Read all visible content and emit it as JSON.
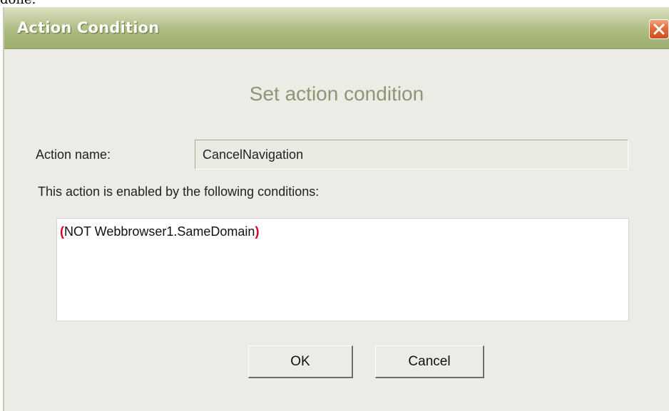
{
  "page": {
    "top_fragment": "done."
  },
  "dialog": {
    "title": "Action Condition",
    "close_icon": "close-icon",
    "heading": "Set action condition",
    "action_name_label": "Action name:",
    "action_name_value": "CancelNavigation",
    "conditions_label": "This action is enabled by the following conditions:",
    "condition": {
      "open_paren": "(",
      "expression": "NOT Webbrowser1.SameDomain",
      "close_paren": ")"
    },
    "ok_label": "OK",
    "cancel_label": "Cancel"
  },
  "colors": {
    "titlebar": "#a9b87c",
    "heading": "#8d9773",
    "paren": "#d8001a",
    "close_button": "#e26b3a",
    "window_bg": "#ecebe5"
  }
}
